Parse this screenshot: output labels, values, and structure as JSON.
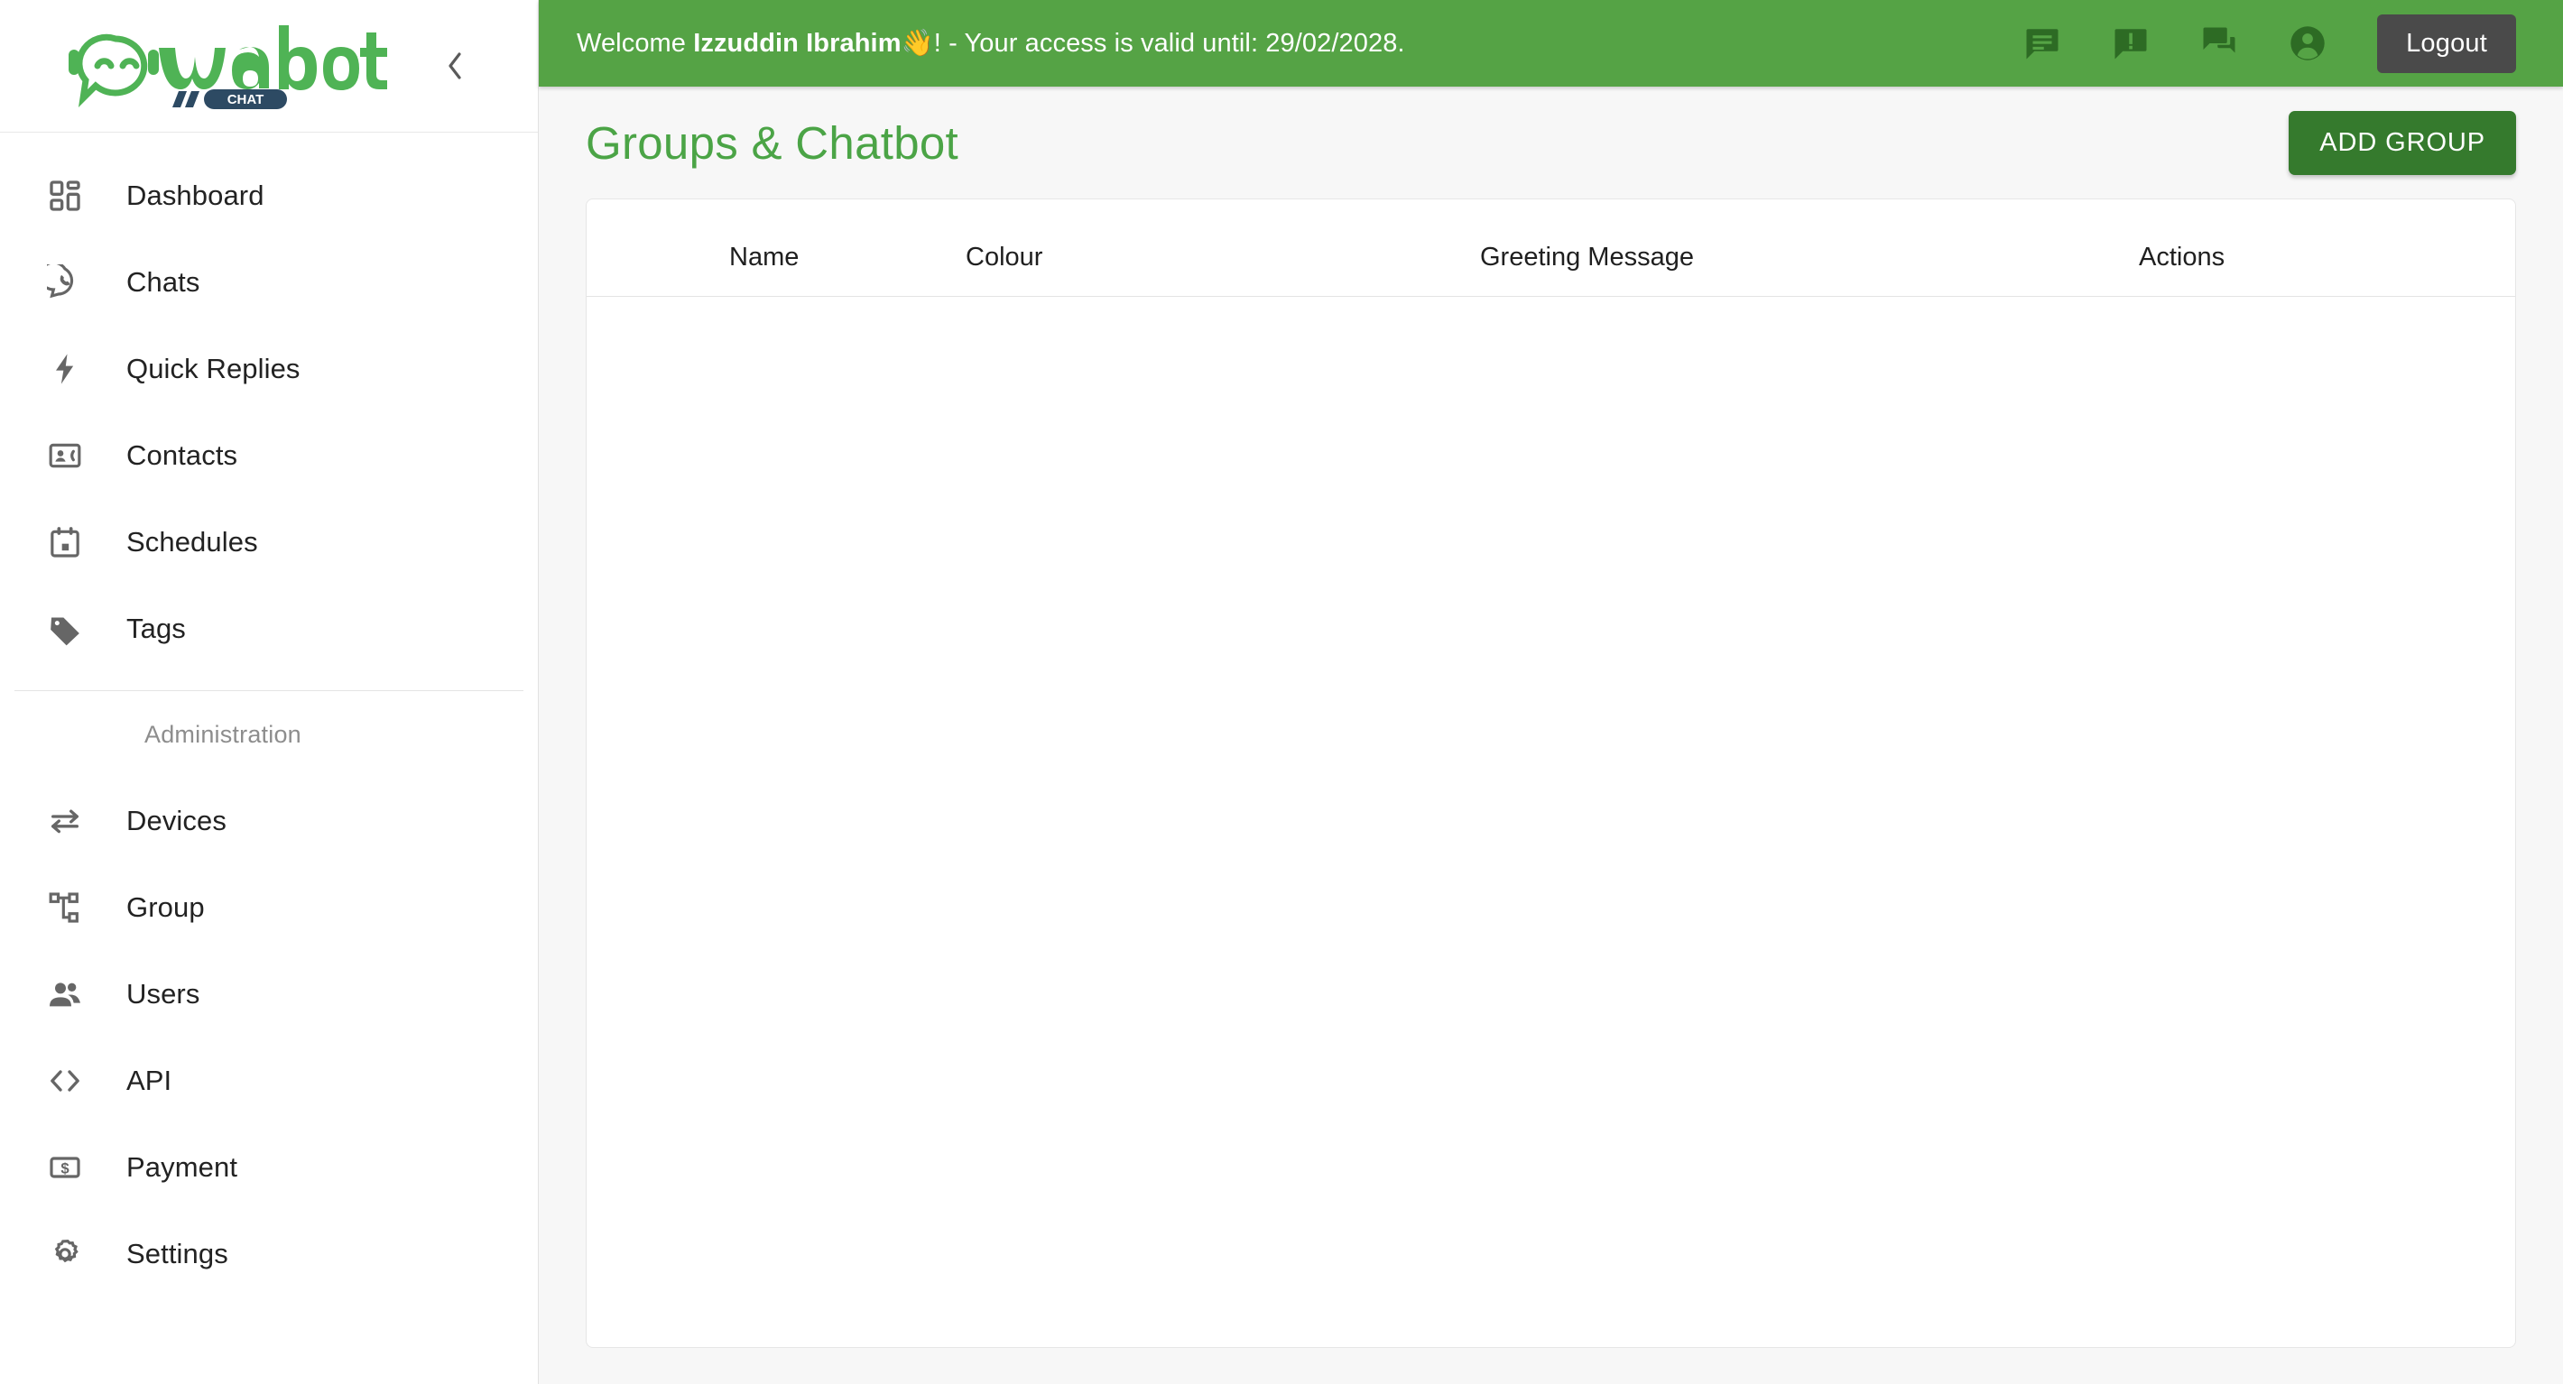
{
  "brand": {
    "name": "wabot",
    "badge": "CHAT"
  },
  "sidebar": {
    "collapse_icon": "chevron-left-icon",
    "items": [
      {
        "label": "Dashboard",
        "icon": "dashboard-icon"
      },
      {
        "label": "Chats",
        "icon": "whatsapp-chat-icon"
      },
      {
        "label": "Quick Replies",
        "icon": "bolt-icon"
      },
      {
        "label": "Contacts",
        "icon": "contact-card-icon"
      },
      {
        "label": "Schedules",
        "icon": "calendar-icon"
      },
      {
        "label": "Tags",
        "icon": "tag-icon"
      }
    ],
    "section_title": "Administration",
    "admin_items": [
      {
        "label": "Devices",
        "icon": "swap-horizontal-icon"
      },
      {
        "label": "Group",
        "icon": "sitemap-icon"
      },
      {
        "label": "Users",
        "icon": "users-icon"
      },
      {
        "label": "API",
        "icon": "code-brackets-icon"
      },
      {
        "label": "Payment",
        "icon": "money-icon"
      },
      {
        "label": "Settings",
        "icon": "gear-icon"
      }
    ]
  },
  "topbar": {
    "welcome_prefix": "Welcome ",
    "user_name": "Izzuddin Ibrahim",
    "wave_emoji": "👋",
    "welcome_suffix": "! - Your access is valid until: ",
    "valid_until": "29/02/2028.",
    "icons": [
      "feedback-message-icon",
      "announcement-alert-icon",
      "forum-chat-icon",
      "account-circle-icon"
    ],
    "logout_label": "Logout"
  },
  "main": {
    "page_title": "Groups & Chatbot",
    "add_group_label": "ADD GROUP",
    "table": {
      "columns": [
        "Name",
        "Colour",
        "Greeting Message",
        "Actions"
      ],
      "rows": []
    }
  },
  "colors": {
    "header_green": "#55a345",
    "title_green": "#4ba446",
    "button_green": "#357a2d",
    "logout_gray": "#4a4a4a",
    "icon_dark_green": "#2d6b24",
    "badge_navy": "#2d4a63",
    "page_bg": "#f7f7f7"
  }
}
